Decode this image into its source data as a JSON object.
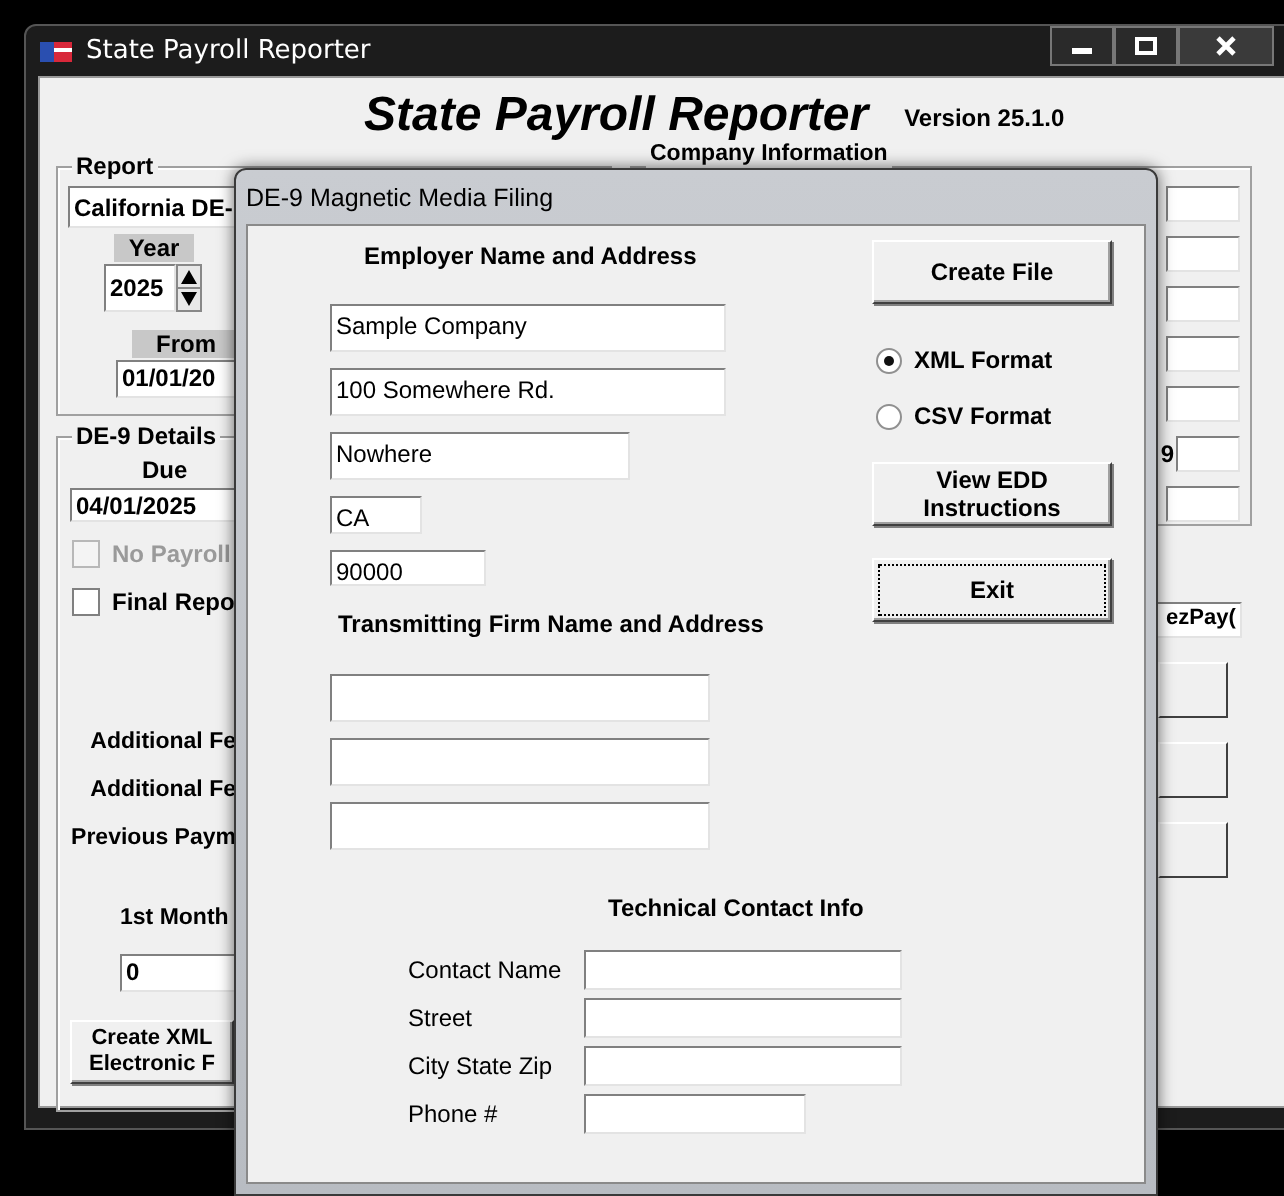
{
  "main_window": {
    "title": "State Payroll Reporter",
    "heading": "State Payroll Reporter",
    "version": "Version 25.1.0",
    "report_group": {
      "label": "Report",
      "report_select": "California DE-",
      "year_label": "Year",
      "year": "2025",
      "from_label": "From",
      "from_date": "01/01/20"
    },
    "details_group": {
      "label": "DE-9 Details",
      "due_label": "Due",
      "due_date": "04/01/2025",
      "checkboxes": [
        {
          "label": "No Payroll",
          "checked": false,
          "disabled": true
        },
        {
          "label": "Final Repo",
          "checked": false,
          "disabled": false
        }
      ],
      "amount_labels": [
        "Additional Fe",
        "Additional Fe",
        "Previous Paym"
      ],
      "month_label": "1st Month",
      "month_value": "0",
      "create_button": [
        "Create XML",
        "Electronic F"
      ]
    },
    "company_group": {
      "label": "Company Information",
      "side_label": "9"
    },
    "side_field": "ezPay("
  },
  "dialog": {
    "title": "DE-9 Magnetic Media Filing",
    "employer_heading": "Employer Name and Address",
    "employer_fields": [
      {
        "kind": "wide",
        "value": "Sample Company"
      },
      {
        "kind": "wide",
        "value": "100 Somewhere Rd."
      },
      {
        "kind": "medium",
        "value": "Nowhere"
      },
      {
        "kind": "tiny",
        "value": "CA"
      },
      {
        "kind": "small",
        "value": "90000"
      }
    ],
    "transmitting_heading": "Transmitting Firm Name and Address",
    "transmitting_fields": [
      {
        "kind": "wide"
      },
      {
        "kind": "wide"
      },
      {
        "kind": "wide"
      }
    ],
    "contact_heading": "Technical Contact Info",
    "contact_fields": [
      {
        "label": "Contact Name",
        "kind": "long"
      },
      {
        "label": "Street",
        "kind": "long"
      },
      {
        "label": "City State Zip",
        "kind": "long"
      },
      {
        "label": "Phone #",
        "kind": "short"
      }
    ],
    "create_button": "Create File",
    "formats": [
      {
        "label": "XML Format",
        "selected": true
      },
      {
        "label": "CSV Format",
        "selected": false
      }
    ],
    "instructions_button": [
      "View EDD",
      "Instructions"
    ],
    "exit_button": {
      "label": "Exit",
      "focused": true
    }
  }
}
